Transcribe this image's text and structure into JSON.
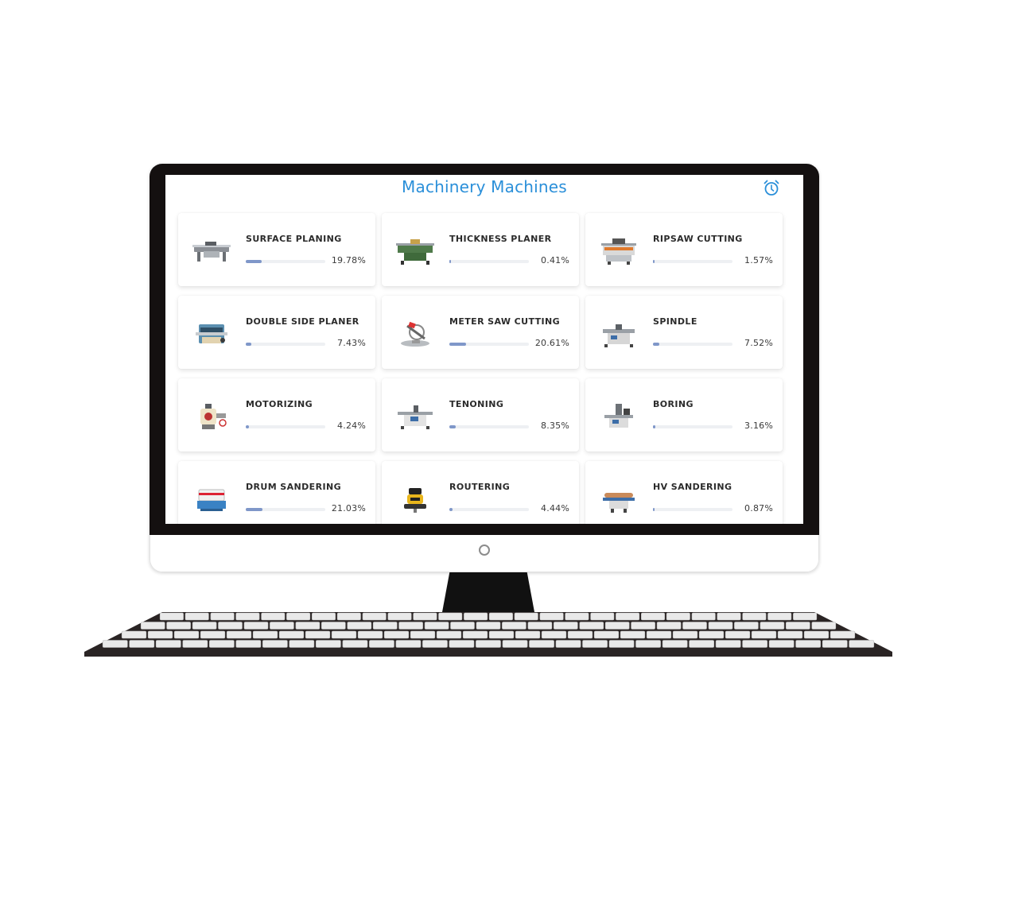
{
  "header": {
    "title": "Machinery Machines",
    "alarm_icon": "alarm-clock-icon",
    "accent_color": "#2a8fd9"
  },
  "machines": [
    {
      "name": "SURFACE PLANING",
      "percent_label": "19.78%",
      "percent": 19.78,
      "icon": "surface-planer"
    },
    {
      "name": "THICKNESS PLANER",
      "percent_label": "0.41%",
      "percent": 0.41,
      "icon": "thickness-planer"
    },
    {
      "name": "RIPSAW CUTTING",
      "percent_label": "1.57%",
      "percent": 1.57,
      "icon": "ripsaw"
    },
    {
      "name": "DOUBLE SIDE PLANER",
      "percent_label": "7.43%",
      "percent": 7.43,
      "icon": "double-side-planer"
    },
    {
      "name": "METER SAW CUTTING",
      "percent_label": "20.61%",
      "percent": 20.61,
      "icon": "meter-saw"
    },
    {
      "name": "SPINDLE",
      "percent_label": "7.52%",
      "percent": 7.52,
      "icon": "spindle"
    },
    {
      "name": "MOTORIZING",
      "percent_label": "4.24%",
      "percent": 4.24,
      "icon": "motorizing"
    },
    {
      "name": "TENONING",
      "percent_label": "8.35%",
      "percent": 8.35,
      "icon": "tenoning"
    },
    {
      "name": "BORING",
      "percent_label": "3.16%",
      "percent": 3.16,
      "icon": "boring"
    },
    {
      "name": "DRUM SANDERING",
      "percent_label": "21.03%",
      "percent": 21.03,
      "icon": "drum-sander"
    },
    {
      "name": "ROUTERING",
      "percent_label": "4.44%",
      "percent": 4.44,
      "icon": "router"
    },
    {
      "name": "HV SANDERING",
      "percent_label": "0.87%",
      "percent": 0.87,
      "icon": "hv-sander"
    }
  ],
  "colors": {
    "progress_fill": "#7f97c9",
    "progress_track": "#eef0f3",
    "bezel": "#141010"
  }
}
